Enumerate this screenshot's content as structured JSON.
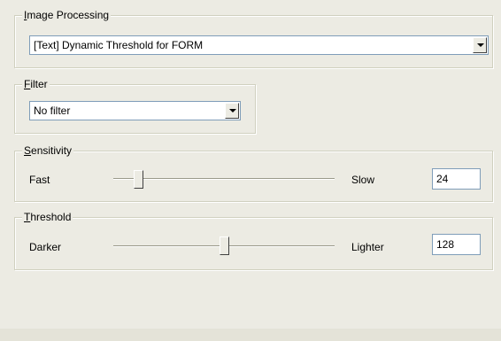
{
  "image_processing": {
    "legend_mnemonic": "I",
    "legend_rest": "mage Processing",
    "selected": "[Text] Dynamic Threshold for FORM"
  },
  "filter": {
    "legend_mnemonic": "F",
    "legend_rest": "ilter",
    "selected": "No filter"
  },
  "sensitivity": {
    "legend_mnemonic": "S",
    "legend_rest": "ensitivity",
    "left_label": "Fast",
    "right_label": "Slow",
    "value": "24"
  },
  "threshold": {
    "legend_mnemonic": "T",
    "legend_rest": "hreshold",
    "left_label": "Darker",
    "right_label": "Lighter",
    "value": "128"
  },
  "icons": {
    "dropdown": "chevron-down-icon"
  }
}
